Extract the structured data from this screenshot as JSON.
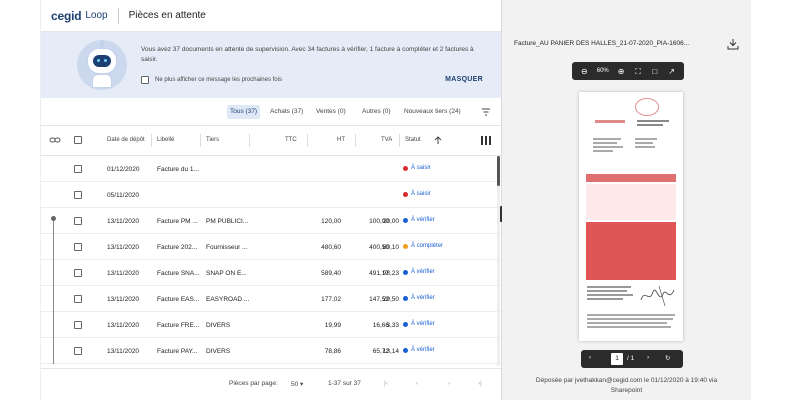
{
  "header": {
    "brand": "cegid",
    "brand_sub": "Loop",
    "title": "Pièces en attente"
  },
  "banner": {
    "message": "Vous avez 37 documents en attente de supervision. Avec 34 factures à vérifier, 1 facture à compléter et 2 factures à saisir.",
    "checkbox_label": "Ne plus afficher ce message les prochaines fois",
    "hide_label": "MASQUER"
  },
  "filters": [
    "Tous (37)",
    "Achats (37)",
    "Ventes (0)",
    "Autres (0)",
    "Nouveaux tiers (24)"
  ],
  "columns": {
    "date": "Date de dépôt",
    "libelle": "Libellé",
    "tiers": "Tiers",
    "ttc": "TTC",
    "ht": "HT",
    "tva": "TVA",
    "statut": "Statut"
  },
  "rows": [
    {
      "date": "01/12/2020",
      "libelle": "Facture du 1...",
      "tiers": "",
      "ttc": "",
      "ht": "",
      "tva": "",
      "status": "À saisir",
      "status_color": "#d62c2c"
    },
    {
      "date": "05/11/2020",
      "libelle": "",
      "tiers": "",
      "ttc": "",
      "ht": "",
      "tva": "",
      "status": "À saisir",
      "status_color": "#d62c2c"
    },
    {
      "date": "13/11/2020",
      "libelle": "Facture PM ...",
      "tiers": "PM PUBLICI...",
      "ttc": "120,00",
      "ht": "100,00",
      "tva": "20,00",
      "status": "À vérifier",
      "status_color": "#1a5fd0"
    },
    {
      "date": "13/11/2020",
      "libelle": "Facture 202...",
      "tiers": "Fournisseur ...",
      "ttc": "480,60",
      "ht": "400,50",
      "tva": "80,10",
      "status": "À compléter",
      "status_color": "#f0a020"
    },
    {
      "date": "13/11/2020",
      "libelle": "Facture SNA...",
      "tiers": "SNAP ON E...",
      "ttc": "589,40",
      "ht": "491,17",
      "tva": "98,23",
      "status": "À vérifier",
      "status_color": "#1a5fd0"
    },
    {
      "date": "13/11/2020",
      "libelle": "Facture EAS...",
      "tiers": "EASYROAD ...",
      "ttc": "177,02",
      "ht": "147,52",
      "tva": "29,50",
      "status": "À vérifier",
      "status_color": "#1a5fd0"
    },
    {
      "date": "13/11/2020",
      "libelle": "Facture FRE...",
      "tiers": "DIVERS",
      "ttc": "19,99",
      "ht": "16,66",
      "tva": "3,33",
      "status": "À vérifier",
      "status_color": "#1a5fd0"
    },
    {
      "date": "13/11/2020",
      "libelle": "Facture PAY...",
      "tiers": "DIVERS",
      "ttc": "78,86",
      "ht": "65,72",
      "tva": "13,14",
      "status": "À vérifier",
      "status_color": "#1a5fd0"
    }
  ],
  "pagination": {
    "per_page_label": "Pièces par page:",
    "per_page": "50",
    "range": "1-37 sur 37"
  },
  "preview": {
    "filename": "Facture_AU PANIER DES HALLES_21-07-2020_PIA-1606...",
    "zoom": "60%",
    "page_current": "1",
    "page_total": "/ 1",
    "deposit_line1": "Déposée par jvethakkan@cegid.com le 01/12/2020 à 19:40 via",
    "deposit_line2": "Sharepoint"
  }
}
